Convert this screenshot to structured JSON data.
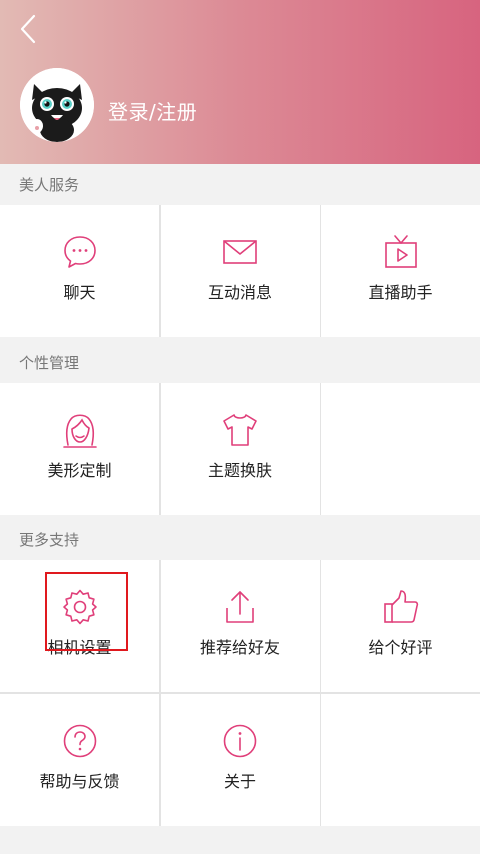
{
  "header": {
    "login_label": "登录/注册"
  },
  "sections": [
    {
      "title": "美人服务",
      "items": [
        {
          "label": "聊天",
          "icon": "chat-bubble-icon"
        },
        {
          "label": "互动消息",
          "icon": "envelope-icon"
        },
        {
          "label": "直播助手",
          "icon": "tv-icon"
        }
      ]
    },
    {
      "title": "个性管理",
      "items": [
        {
          "label": "美形定制",
          "icon": "woman-face-icon"
        },
        {
          "label": "主题换肤",
          "icon": "tshirt-icon"
        }
      ]
    },
    {
      "title": "更多支持",
      "items": [
        {
          "label": "相机设置",
          "icon": "gear-icon"
        },
        {
          "label": "推荐给好友",
          "icon": "share-icon"
        },
        {
          "label": "给个好评",
          "icon": "thumbs-up-icon"
        },
        {
          "label": "帮助与反馈",
          "icon": "question-icon"
        },
        {
          "label": "关于",
          "icon": "info-icon"
        }
      ]
    }
  ],
  "colors": {
    "accent": "#e03f7a",
    "header_left": "#e2bab4",
    "header_right": "#d7647f",
    "highlight": "#e0191e"
  }
}
